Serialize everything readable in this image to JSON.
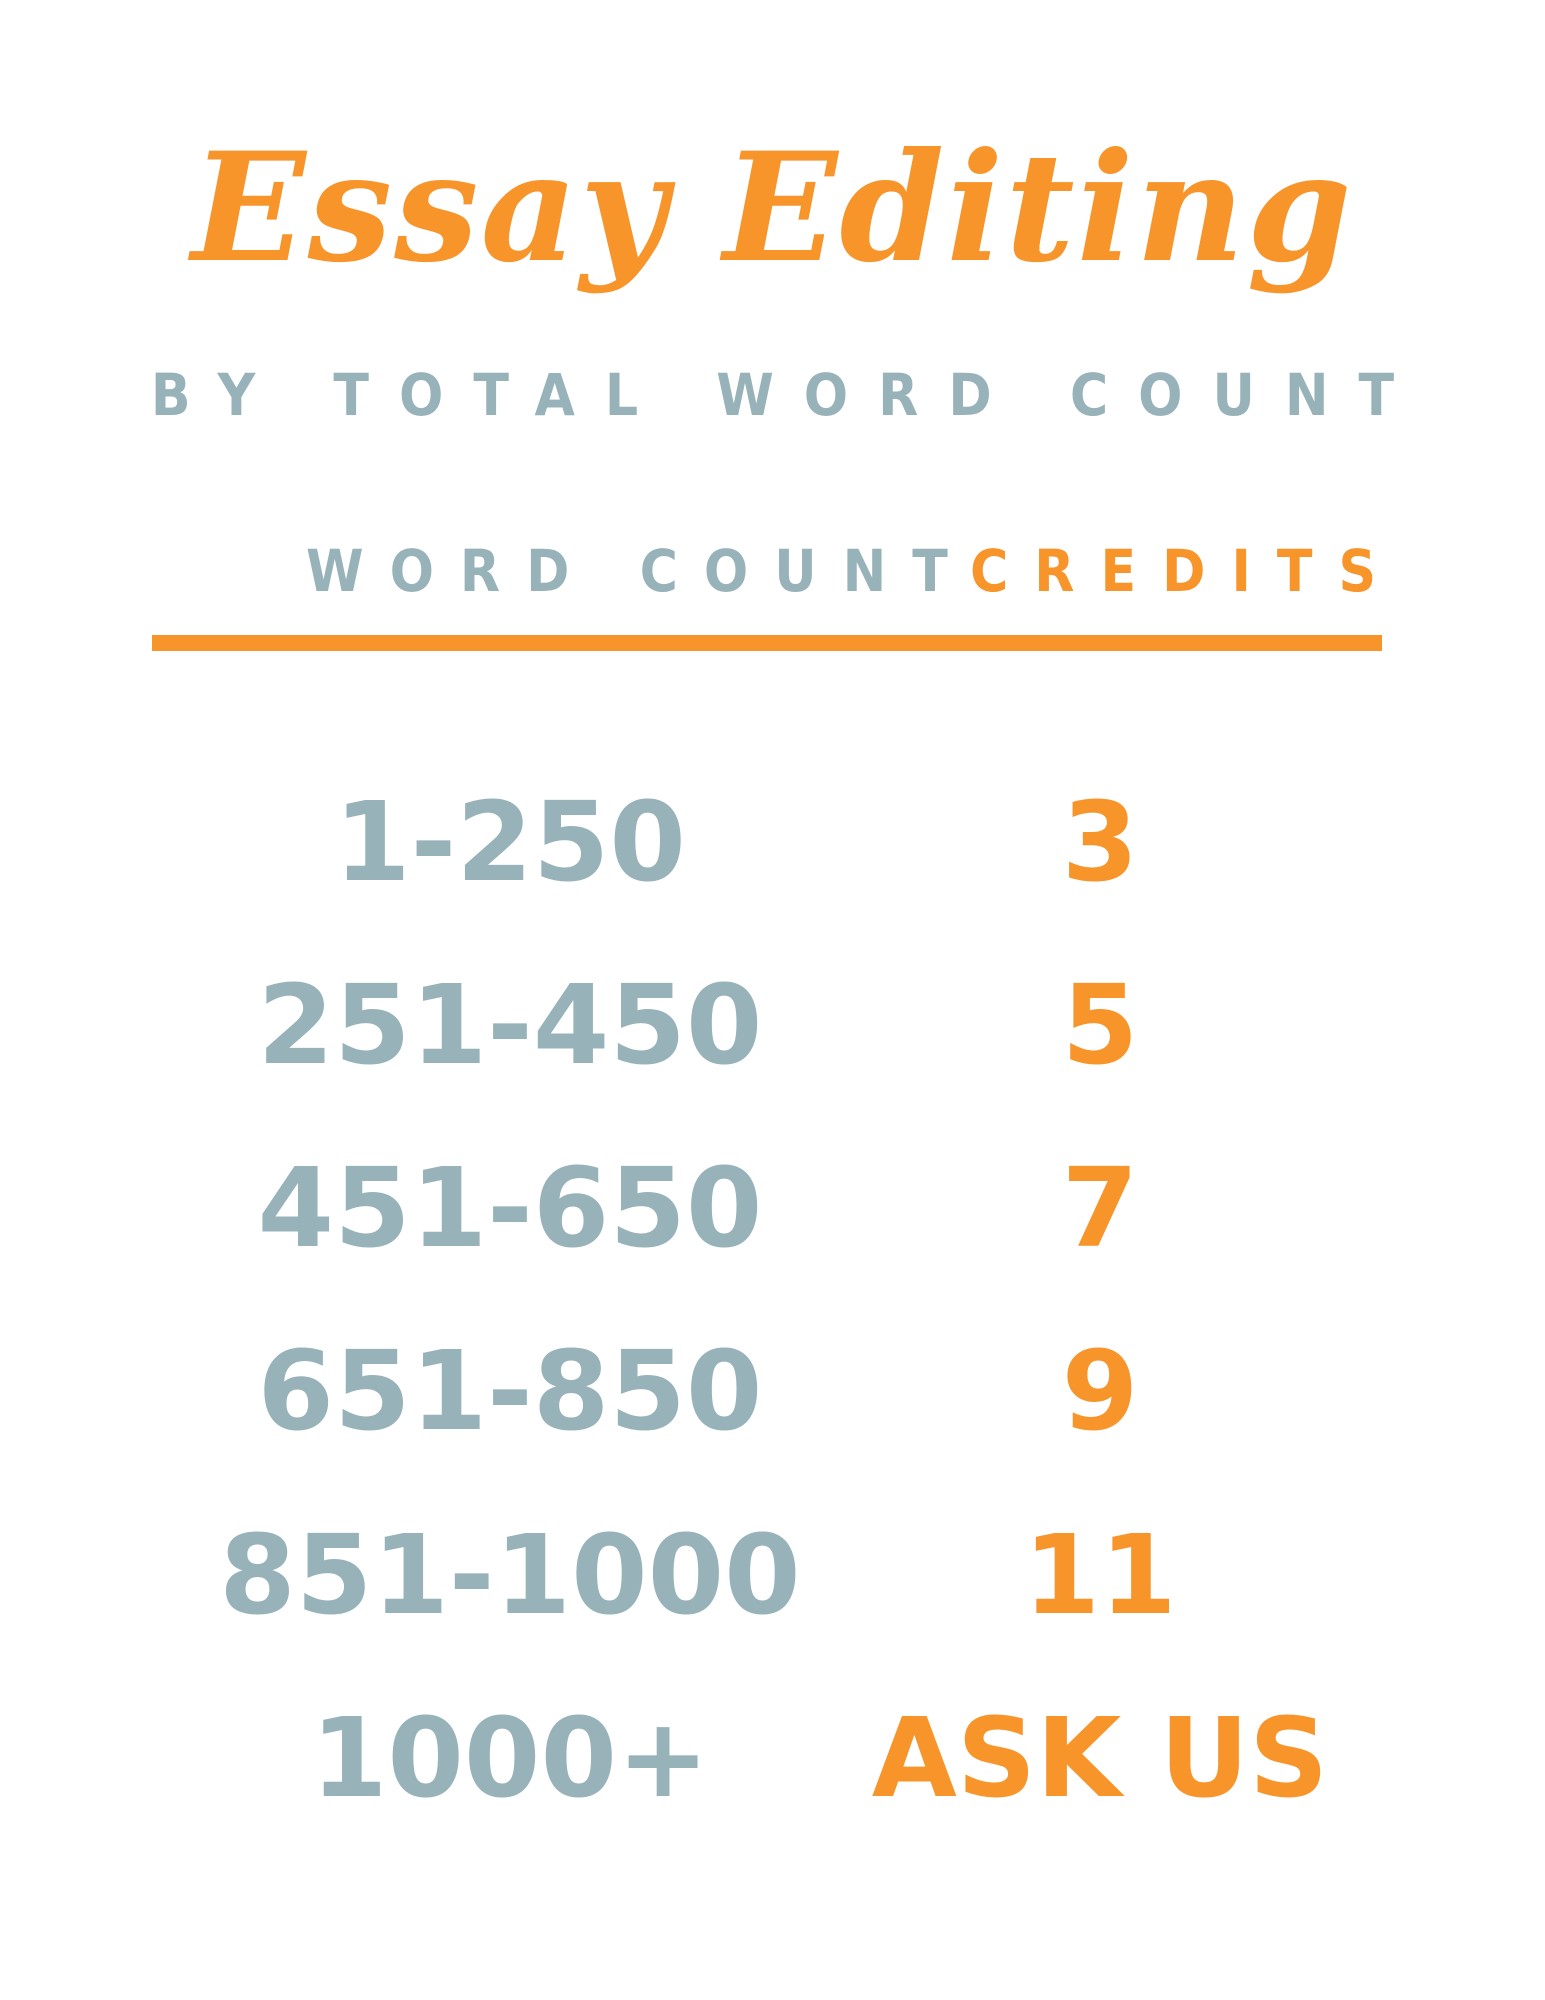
{
  "title": "Essay Editing",
  "subtitle": "BY TOTAL WORD COUNT",
  "table": {
    "headers": {
      "word_count": "WORD COUNT",
      "credits": "CREDITS"
    },
    "rows": [
      {
        "word_count": "1-250",
        "credits": "3"
      },
      {
        "word_count": "251-450",
        "credits": "5"
      },
      {
        "word_count": "451-650",
        "credits": "7"
      },
      {
        "word_count": "651-850",
        "credits": "9"
      },
      {
        "word_count": "851-1000",
        "credits": "11"
      },
      {
        "word_count": "1000+",
        "credits": "ASK US"
      }
    ]
  },
  "colors": {
    "accent": "#f7942a",
    "secondary": "#97b3b9",
    "background": "#ffffff"
  }
}
